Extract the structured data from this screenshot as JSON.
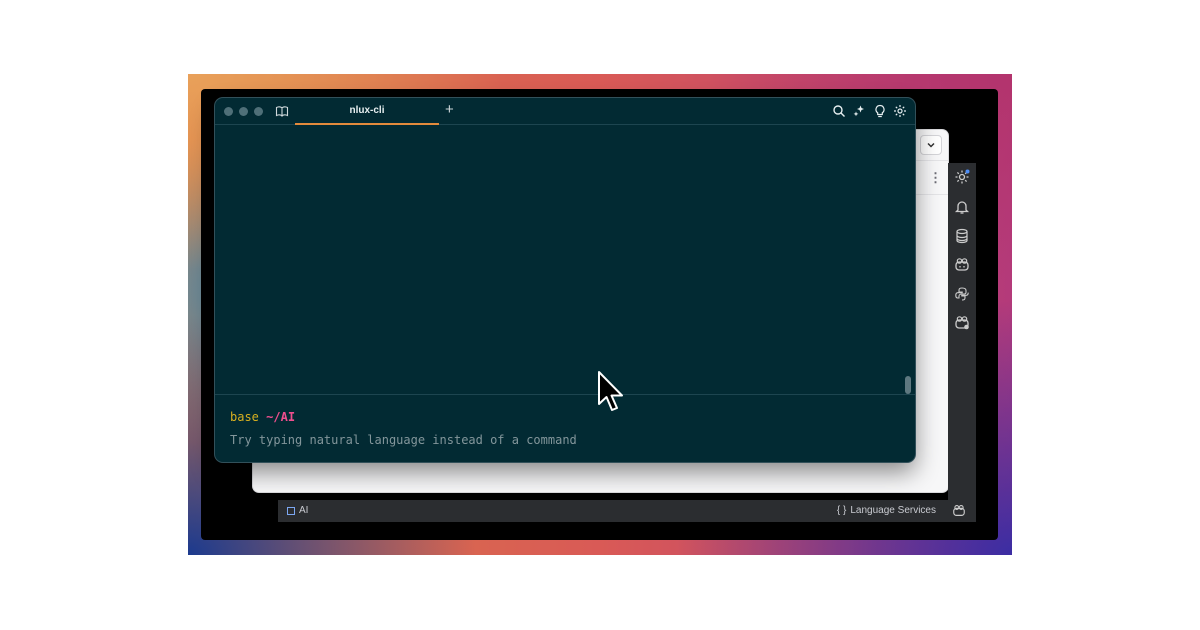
{
  "terminal": {
    "tab_title": "nlux-cli",
    "new_tab_symbol": "+",
    "prompt_env": "base",
    "prompt_dir": "~/AI",
    "input_placeholder": "Try typing natural language instead of a command",
    "toolbar_icons": [
      "search-icon",
      "sparkle-icon",
      "lightbulb-icon",
      "gear-icon"
    ]
  },
  "sidebar": {
    "icons": [
      "settings-icon",
      "bell-icon",
      "database-icon",
      "copilot-icon",
      "python-icon",
      "ai-assistant-icon"
    ]
  },
  "statusbar": {
    "left_label": "AI",
    "right_label": "Language Services",
    "right_symbol": "{ }"
  },
  "colors": {
    "terminal_bg": "#022a33",
    "tab_underline": "#e38a3c",
    "prompt_env": "#d8b020",
    "prompt_dir": "#ef4f8e",
    "hint_text": "#83969b"
  }
}
